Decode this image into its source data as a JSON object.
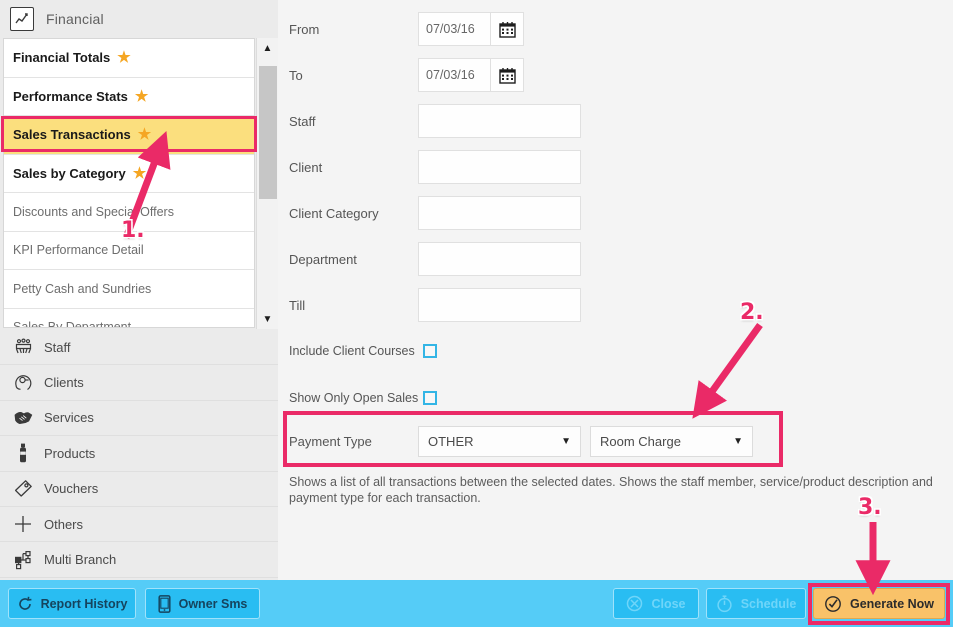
{
  "sidebar": {
    "category": {
      "label": "Financial",
      "icon": "line-chart-icon"
    },
    "reports": [
      {
        "label": "Financial Totals",
        "favorite": true,
        "selected": false
      },
      {
        "label": "Performance Stats",
        "favorite": true,
        "selected": false
      },
      {
        "label": "Sales Transactions",
        "favorite": true,
        "selected": true
      },
      {
        "label": "Sales by Category",
        "favorite": true,
        "selected": false
      },
      {
        "label": "Discounts and Special Offers",
        "favorite": false,
        "selected": false
      },
      {
        "label": "KPI Performance Detail",
        "favorite": false,
        "selected": false
      },
      {
        "label": "Petty Cash and Sundries",
        "favorite": false,
        "selected": false
      },
      {
        "label": "Sales By Department",
        "favorite": false,
        "selected": false
      }
    ],
    "star_glyph": "★",
    "scrollbar": {
      "up": "▲",
      "down": "▼"
    },
    "nav": [
      {
        "label": "Staff",
        "icon": "staff-icon"
      },
      {
        "label": "Clients",
        "icon": "client-head-icon"
      },
      {
        "label": "Services",
        "icon": "handshake-icon"
      },
      {
        "label": "Products",
        "icon": "bottle-icon"
      },
      {
        "label": "Vouchers",
        "icon": "tag-icon"
      },
      {
        "label": "Others",
        "icon": "plus-icon"
      },
      {
        "label": "Multi Branch",
        "icon": "branch-network-icon"
      }
    ]
  },
  "form": {
    "fields": [
      {
        "label": "From",
        "type": "date",
        "value": "07/03/16"
      },
      {
        "label": "To",
        "type": "date",
        "value": "07/03/16"
      },
      {
        "label": "Staff",
        "type": "text",
        "value": ""
      },
      {
        "label": "Client",
        "type": "text",
        "value": ""
      },
      {
        "label": "Client Category",
        "type": "text",
        "value": ""
      },
      {
        "label": "Department",
        "type": "text",
        "value": ""
      },
      {
        "label": "Till",
        "type": "text",
        "value": ""
      }
    ],
    "checkboxes": [
      {
        "label": "Include Client Courses",
        "checked": false
      },
      {
        "label": "Show Only Open Sales",
        "checked": false
      }
    ],
    "payment": {
      "label": "Payment Type",
      "primary_value": "OTHER",
      "secondary_value": "Room Charge",
      "caret": "▼"
    },
    "description": "Shows a list of all transactions between the selected dates. Shows the staff member, service/product description and payment type for each transaction."
  },
  "bottom_bar": {
    "left_buttons": [
      {
        "label": "Report History",
        "icon": "refresh-circle-icon"
      },
      {
        "label": "Owner Sms",
        "icon": "mobile-phone-icon"
      }
    ],
    "right_buttons": [
      {
        "label": "Close",
        "icon": "close-circle-icon",
        "style": "light"
      },
      {
        "label": "Schedule",
        "icon": "stopwatch-icon",
        "style": "light"
      },
      {
        "label": "Generate Now",
        "icon": "check-circle-icon",
        "style": "generate"
      }
    ]
  },
  "annotations": {
    "accent_color": "#ea2a67",
    "steps": [
      {
        "number": "1.",
        "target": "sales-transactions-report"
      },
      {
        "number": "2.",
        "target": "payment-type-row"
      },
      {
        "number": "3.",
        "target": "generate-now-button"
      }
    ]
  }
}
